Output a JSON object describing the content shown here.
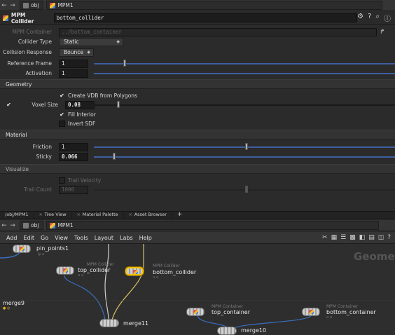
{
  "top_path": {
    "back": "←",
    "forward": "→",
    "context": "obj",
    "node": "MPM1"
  },
  "parm_header": {
    "node_type": "MPM Collider",
    "node_name": "bottom_collider"
  },
  "parms": {
    "mpm_container": {
      "label": "MPM Container",
      "value": "../bottom_container"
    },
    "collider_type": {
      "label": "Collider Type",
      "value": "Static"
    },
    "collision_response": {
      "label": "Collision Response",
      "value": "Bounce"
    },
    "reference_frame": {
      "label": "Reference Frame",
      "value": "1",
      "slider_fraction": 0.1
    },
    "activation": {
      "label": "Activation",
      "value": "1"
    }
  },
  "geometry": {
    "title": "Geometry",
    "create_vdb": {
      "label": "Create VDB from Polygons",
      "checked": true
    },
    "voxel_size": {
      "label": "Voxel Size",
      "value": "0.08",
      "slider_fraction": 0.08
    },
    "fill_interior": {
      "label": "Fill Interior",
      "checked": true
    },
    "invert_sdf": {
      "label": "Invert SDF",
      "checked": false
    }
  },
  "material": {
    "title": "Material",
    "friction": {
      "label": "Friction",
      "value": "1",
      "slider_fraction": 0.5
    },
    "sticky": {
      "label": "Sticky",
      "value": "0.066",
      "slider_fraction": 0.066
    }
  },
  "visualize": {
    "title": "Visualize",
    "trail_velocity": {
      "label": "Trail Velocity"
    },
    "trail_count": {
      "label": "Trail Count",
      "value": "1000"
    }
  },
  "pane_tabs": [
    "/obj/MPM1",
    "Tree View",
    "Material Palette",
    "Asset Browser"
  ],
  "net_path": {
    "context": "obj",
    "node": "MPM1"
  },
  "net_menu": [
    "Add",
    "Edit",
    "Go",
    "View",
    "Tools",
    "Layout",
    "Labs",
    "Help"
  ],
  "network": {
    "watermark": "Geometr",
    "nodes": [
      {
        "name": "pin_points1",
        "type": ""
      },
      {
        "name": "top_collider",
        "type": "MPM Collider"
      },
      {
        "name": "bottom_collider",
        "type": "MPM Collider",
        "selected": true
      },
      {
        "name": "merge9",
        "type": ""
      },
      {
        "name": "merge11",
        "type": ""
      },
      {
        "name": "top_container",
        "type": "MPM Container"
      },
      {
        "name": "bottom_container",
        "type": "MPM Container"
      },
      {
        "name": "merge10",
        "type": ""
      }
    ]
  },
  "colors": {
    "accent": "#3d5ea0",
    "selection": "#f0c000",
    "panel": "#2b2b2b"
  }
}
